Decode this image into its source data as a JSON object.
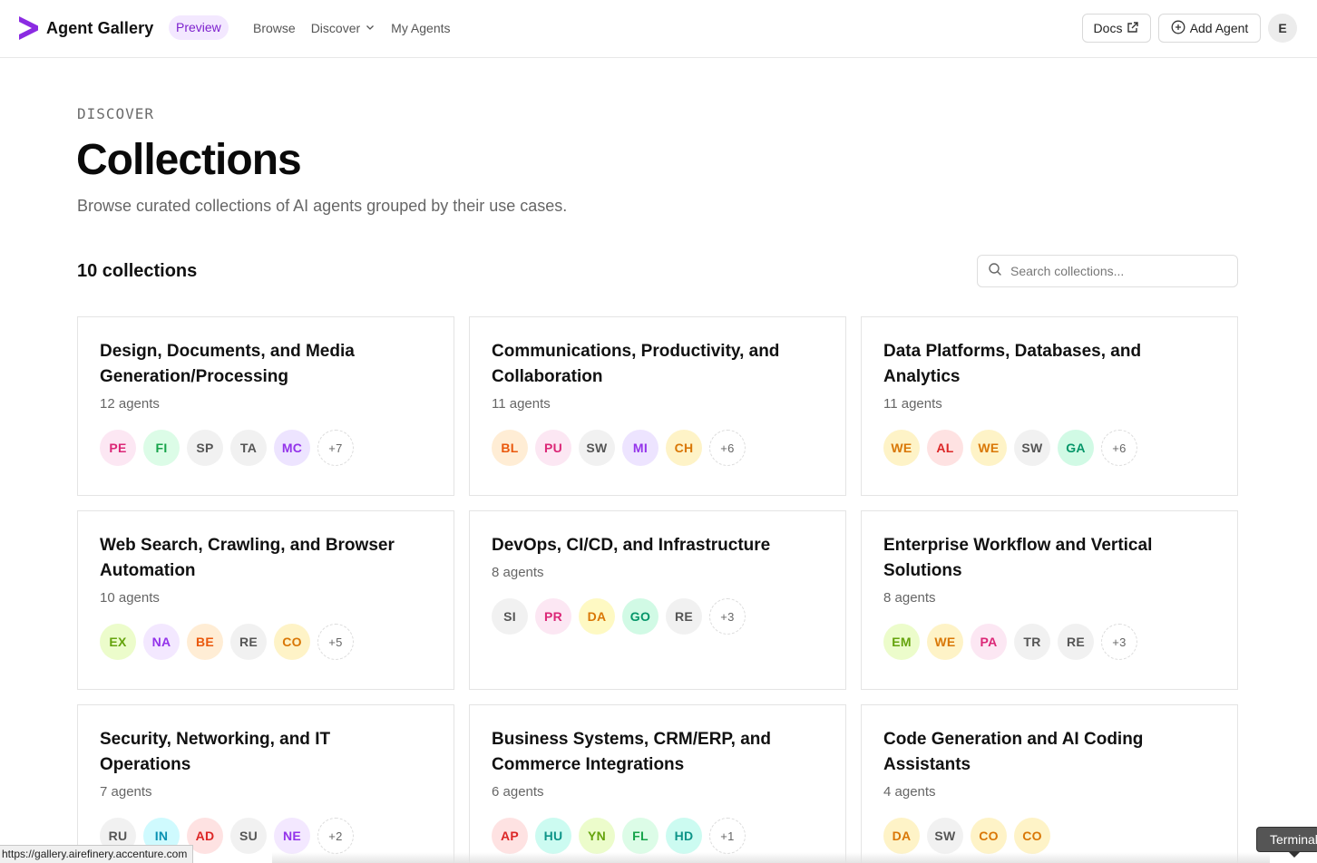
{
  "header": {
    "brand": "Agent Gallery",
    "badge": "Preview",
    "nav": [
      {
        "label": "Browse",
        "icon": ""
      },
      {
        "label": "Discover",
        "icon": "chevron-down-icon"
      },
      {
        "label": "My Agents",
        "icon": ""
      }
    ],
    "docs_label": "Docs",
    "add_label": "Add Agent",
    "user_initial": "E",
    "accent": "#8b2be2"
  },
  "page": {
    "eyebrow": "DISCOVER",
    "title": "Collections",
    "subtitle": "Browse curated collections of AI agents grouped by their use cases."
  },
  "toolbar": {
    "count_label": "10 collections",
    "search_placeholder": "Search collections..."
  },
  "collections": [
    {
      "title": "Design, Documents, and Media Generation/Processing",
      "count": "12 agents",
      "avatars": [
        {
          "text": "PE",
          "bg": "#fce7f3",
          "fg": "#db2777"
        },
        {
          "text": "FI",
          "bg": "#dcfce7",
          "fg": "#16a34a"
        },
        {
          "text": "SP",
          "bg": "#f1f1f1",
          "fg": "#555555"
        },
        {
          "text": "TA",
          "bg": "#f1f1f1",
          "fg": "#555555"
        },
        {
          "text": "MC",
          "bg": "#ede4ff",
          "fg": "#9333ea"
        }
      ],
      "more": "+7"
    },
    {
      "title": "Communications, Productivity, and Collaboration",
      "count": "11 agents",
      "avatars": [
        {
          "text": "BL",
          "bg": "#ffedd5",
          "fg": "#ea580c"
        },
        {
          "text": "PU",
          "bg": "#fce7f3",
          "fg": "#db2777"
        },
        {
          "text": "SW",
          "bg": "#f1f1f1",
          "fg": "#555555"
        },
        {
          "text": "MI",
          "bg": "#ede4ff",
          "fg": "#9333ea"
        },
        {
          "text": "CH",
          "bg": "#fef3c7",
          "fg": "#d97706"
        }
      ],
      "more": "+6"
    },
    {
      "title": "Data Platforms, Databases, and Analytics",
      "count": "11 agents",
      "avatars": [
        {
          "text": "WE",
          "bg": "#fef3c7",
          "fg": "#d97706"
        },
        {
          "text": "AL",
          "bg": "#fee2e2",
          "fg": "#dc2626"
        },
        {
          "text": "WE",
          "bg": "#fef3c7",
          "fg": "#d97706"
        },
        {
          "text": "SW",
          "bg": "#f1f1f1",
          "fg": "#555555"
        },
        {
          "text": "GA",
          "bg": "#d1fae5",
          "fg": "#059669"
        }
      ],
      "more": "+6"
    },
    {
      "title": "Web Search, Crawling, and Browser Automation",
      "count": "10 agents",
      "avatars": [
        {
          "text": "EX",
          "bg": "#ecfccb",
          "fg": "#65a30d"
        },
        {
          "text": "NA",
          "bg": "#f3e8ff",
          "fg": "#9333ea"
        },
        {
          "text": "BE",
          "bg": "#ffedd5",
          "fg": "#ea580c"
        },
        {
          "text": "RE",
          "bg": "#f1f1f1",
          "fg": "#555555"
        },
        {
          "text": "CO",
          "bg": "#fef3c7",
          "fg": "#d97706"
        }
      ],
      "more": "+5"
    },
    {
      "title": "DevOps, CI/CD, and Infrastructure",
      "count": "8 agents",
      "avatars": [
        {
          "text": "SI",
          "bg": "#f1f1f1",
          "fg": "#555555"
        },
        {
          "text": "PR",
          "bg": "#fce7f3",
          "fg": "#db2777"
        },
        {
          "text": "DA",
          "bg": "#fef9c3",
          "fg": "#d97706"
        },
        {
          "text": "GO",
          "bg": "#d1fae5",
          "fg": "#059669"
        },
        {
          "text": "RE",
          "bg": "#f1f1f1",
          "fg": "#555555"
        }
      ],
      "more": "+3"
    },
    {
      "title": "Enterprise Workflow and Vertical Solutions",
      "count": "8 agents",
      "avatars": [
        {
          "text": "EM",
          "bg": "#ecfccb",
          "fg": "#65a30d"
        },
        {
          "text": "WE",
          "bg": "#fef3c7",
          "fg": "#d97706"
        },
        {
          "text": "PA",
          "bg": "#fce7f3",
          "fg": "#db2777"
        },
        {
          "text": "TR",
          "bg": "#f1f1f1",
          "fg": "#555555"
        },
        {
          "text": "RE",
          "bg": "#f1f1f1",
          "fg": "#555555"
        }
      ],
      "more": "+3"
    },
    {
      "title": "Security, Networking, and IT Operations",
      "count": "7 agents",
      "avatars": [
        {
          "text": "RU",
          "bg": "#f1f1f1",
          "fg": "#555555"
        },
        {
          "text": "IN",
          "bg": "#cffafe",
          "fg": "#0891b2"
        },
        {
          "text": "AD",
          "bg": "#fee2e2",
          "fg": "#dc2626"
        },
        {
          "text": "SU",
          "bg": "#f1f1f1",
          "fg": "#555555"
        },
        {
          "text": "NE",
          "bg": "#f3e8ff",
          "fg": "#9333ea"
        }
      ],
      "more": "+2"
    },
    {
      "title": "Business Systems, CRM/ERP, and Commerce Integrations",
      "count": "6 agents",
      "avatars": [
        {
          "text": "AP",
          "bg": "#fee2e2",
          "fg": "#dc2626"
        },
        {
          "text": "HU",
          "bg": "#ccfbf1",
          "fg": "#0d9488"
        },
        {
          "text": "YN",
          "bg": "#ecfccb",
          "fg": "#65a30d"
        },
        {
          "text": "FL",
          "bg": "#dcfce7",
          "fg": "#16a34a"
        },
        {
          "text": "HD",
          "bg": "#ccfbf1",
          "fg": "#0d9488"
        }
      ],
      "more": "+1"
    },
    {
      "title": "Code Generation and AI Coding Assistants",
      "count": "4 agents",
      "avatars": [
        {
          "text": "DA",
          "bg": "#fef3c7",
          "fg": "#d97706"
        },
        {
          "text": "SW",
          "bg": "#f1f1f1",
          "fg": "#555555"
        },
        {
          "text": "CO",
          "bg": "#fef3c7",
          "fg": "#d97706"
        },
        {
          "text": "CO",
          "bg": "#fef3c7",
          "fg": "#d97706"
        }
      ],
      "more": ""
    }
  ],
  "status": {
    "url": "https://gallery.airefinery.accenture.com",
    "tooltip": "Terminal"
  }
}
